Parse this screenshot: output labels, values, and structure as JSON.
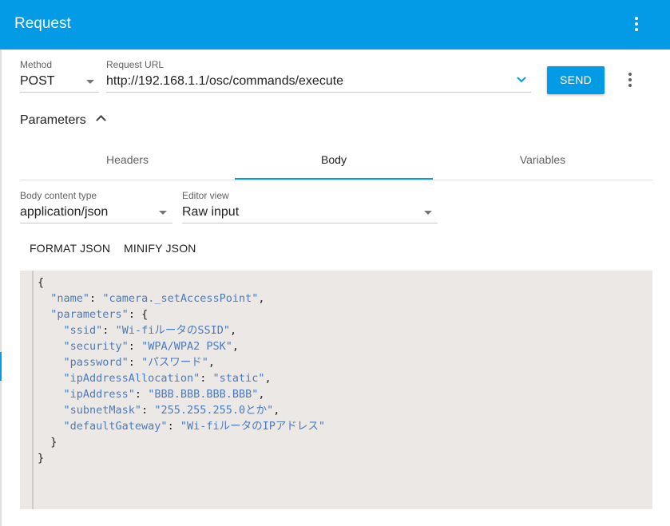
{
  "appbar": {
    "title": "Request"
  },
  "request": {
    "method_label": "Method",
    "method_value": "POST",
    "url_label": "Request URL",
    "url_value": "http://192.168.1.1/osc/commands/execute",
    "send_label": "SEND"
  },
  "parameters": {
    "label": "Parameters",
    "tabs": [
      {
        "label": "Headers",
        "active": false
      },
      {
        "label": "Body",
        "active": true
      },
      {
        "label": "Variables",
        "active": false
      }
    ]
  },
  "body": {
    "content_type_label": "Body content type",
    "content_type_value": "application/json",
    "editor_view_label": "Editor view",
    "editor_view_value": "Raw input",
    "format_json_label": "FORMAT JSON",
    "minify_json_label": "MINIFY JSON"
  },
  "editor": {
    "lines": [
      [
        [
          "p",
          "{"
        ]
      ],
      [
        [
          "p",
          "  "
        ],
        [
          "k",
          "\"name\""
        ],
        [
          "p",
          ": "
        ],
        [
          "s",
          "\"camera._setAccessPoint\""
        ],
        [
          "p",
          ","
        ]
      ],
      [
        [
          "p",
          "  "
        ],
        [
          "k",
          "\"parameters\""
        ],
        [
          "p",
          ": {"
        ]
      ],
      [
        [
          "p",
          "    "
        ],
        [
          "k",
          "\"ssid\""
        ],
        [
          "p",
          ": "
        ],
        [
          "s",
          "\"Wi-fiルータのSSID\""
        ],
        [
          "p",
          ","
        ]
      ],
      [
        [
          "p",
          "    "
        ],
        [
          "k",
          "\"security\""
        ],
        [
          "p",
          ": "
        ],
        [
          "s",
          "\"WPA/WPA2 PSK\""
        ],
        [
          "p",
          ","
        ]
      ],
      [
        [
          "p",
          "    "
        ],
        [
          "k",
          "\"password\""
        ],
        [
          "p",
          ": "
        ],
        [
          "s",
          "\"パスワード\""
        ],
        [
          "p",
          ","
        ]
      ],
      [
        [
          "p",
          "    "
        ],
        [
          "k",
          "\"ipAddressAllocation\""
        ],
        [
          "p",
          ": "
        ],
        [
          "s",
          "\"static\""
        ],
        [
          "p",
          ","
        ]
      ],
      [
        [
          "p",
          "    "
        ],
        [
          "k",
          "\"ipAddress\""
        ],
        [
          "p",
          ": "
        ],
        [
          "s",
          "\"BBB.BBB.BBB.BBB\""
        ],
        [
          "p",
          ","
        ]
      ],
      [
        [
          "p",
          "    "
        ],
        [
          "k",
          "\"subnetMask\""
        ],
        [
          "p",
          ": "
        ],
        [
          "s",
          "\"255.255.255.0とか\""
        ],
        [
          "p",
          ","
        ]
      ],
      [
        [
          "p",
          "    "
        ],
        [
          "k",
          "\"defaultGateway\""
        ],
        [
          "p",
          ": "
        ],
        [
          "s",
          "\"Wi-fiルータのIPアドレス\""
        ]
      ],
      [
        [
          "p",
          "  }"
        ]
      ],
      [
        [
          "p",
          "}"
        ]
      ]
    ]
  },
  "colors": {
    "primary": "#039be5",
    "editor_background": "#ece8e5",
    "json_token": "#4a7bbf"
  },
  "icons": {
    "appbar_menu": "more-vert-icon",
    "url_menu": "more-vert-icon",
    "method_dropdown": "arrow-drop-down-icon",
    "url_dropdown": "chevron-down-icon",
    "parameters_toggle": "chevron-up-icon"
  }
}
